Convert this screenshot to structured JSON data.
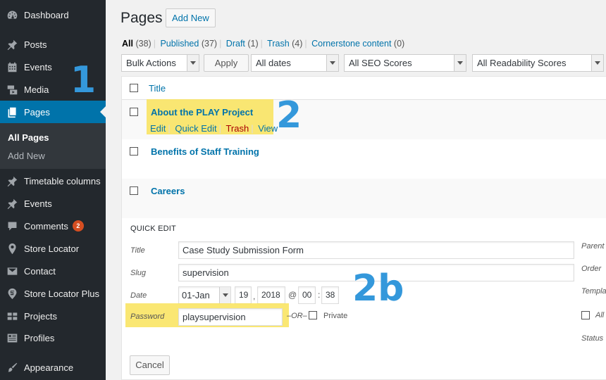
{
  "sidebar": {
    "items": [
      {
        "label": "Dashboard",
        "icon": "dashboard-icon"
      },
      {
        "label": "Posts",
        "icon": "pin-icon"
      },
      {
        "label": "Events",
        "icon": "calendar-icon"
      },
      {
        "label": "Media",
        "icon": "media-icon"
      },
      {
        "label": "Pages",
        "icon": "pages-icon"
      },
      {
        "label": "Timetable columns",
        "icon": "pin-icon"
      },
      {
        "label": "Events",
        "icon": "pin-icon"
      },
      {
        "label": "Comments",
        "icon": "comment-icon",
        "badge": "2"
      },
      {
        "label": "Store Locator",
        "icon": "location-icon"
      },
      {
        "label": "Contact",
        "icon": "mail-icon"
      },
      {
        "label": "Store Locator Plus",
        "icon": "slp-icon"
      },
      {
        "label": "Projects",
        "icon": "projects-icon"
      },
      {
        "label": "Profiles",
        "icon": "profiles-icon"
      },
      {
        "label": "Appearance",
        "icon": "brush-icon"
      }
    ],
    "submenu": [
      "All Pages",
      "Add New"
    ]
  },
  "header": {
    "title": "Pages",
    "add_new": "Add New"
  },
  "filters": {
    "all": "All",
    "all_count": "(38)",
    "published": "Published",
    "published_count": "(37)",
    "draft": "Draft",
    "draft_count": "(1)",
    "trash": "Trash",
    "trash_count": "(4)",
    "cornerstone": "Cornerstone content",
    "cornerstone_count": "(0)"
  },
  "toolbar": {
    "bulk_actions": "Bulk Actions",
    "apply": "Apply",
    "dates": "All dates",
    "seo": "All SEO Scores",
    "readability": "All Readability Scores"
  },
  "table": {
    "column_title": "Title",
    "rows": [
      "About the PLAY Project",
      "Benefits of Staff Training",
      "Careers"
    ],
    "row_actions": {
      "edit": "Edit",
      "quick_edit": "Quick Edit",
      "trash": "Trash",
      "view": "View"
    }
  },
  "quick_edit": {
    "heading": "QUICK EDIT",
    "title_label": "Title",
    "title_value": "Case Study Submission Form",
    "slug_label": "Slug",
    "slug_value": "supervision",
    "date_label": "Date",
    "month": "01-Jan",
    "day": "19",
    "year": "2018",
    "hour": "00",
    "minute": "38",
    "comma": ",",
    "at": "@",
    "colon": ":",
    "password_label": "Password",
    "password_value": "playsupervision",
    "or": "–OR–",
    "private": "Private",
    "right_labels": [
      "Parent",
      "Order",
      "Templa",
      "All",
      "Status"
    ],
    "cancel": "Cancel"
  },
  "annotations": [
    "1",
    "2",
    "2b"
  ],
  "colors": {
    "sidebar": "#23282d",
    "active": "#0073aa",
    "highlight": "#f9e35a",
    "annotation": "#3498db",
    "link": "#0073aa"
  }
}
